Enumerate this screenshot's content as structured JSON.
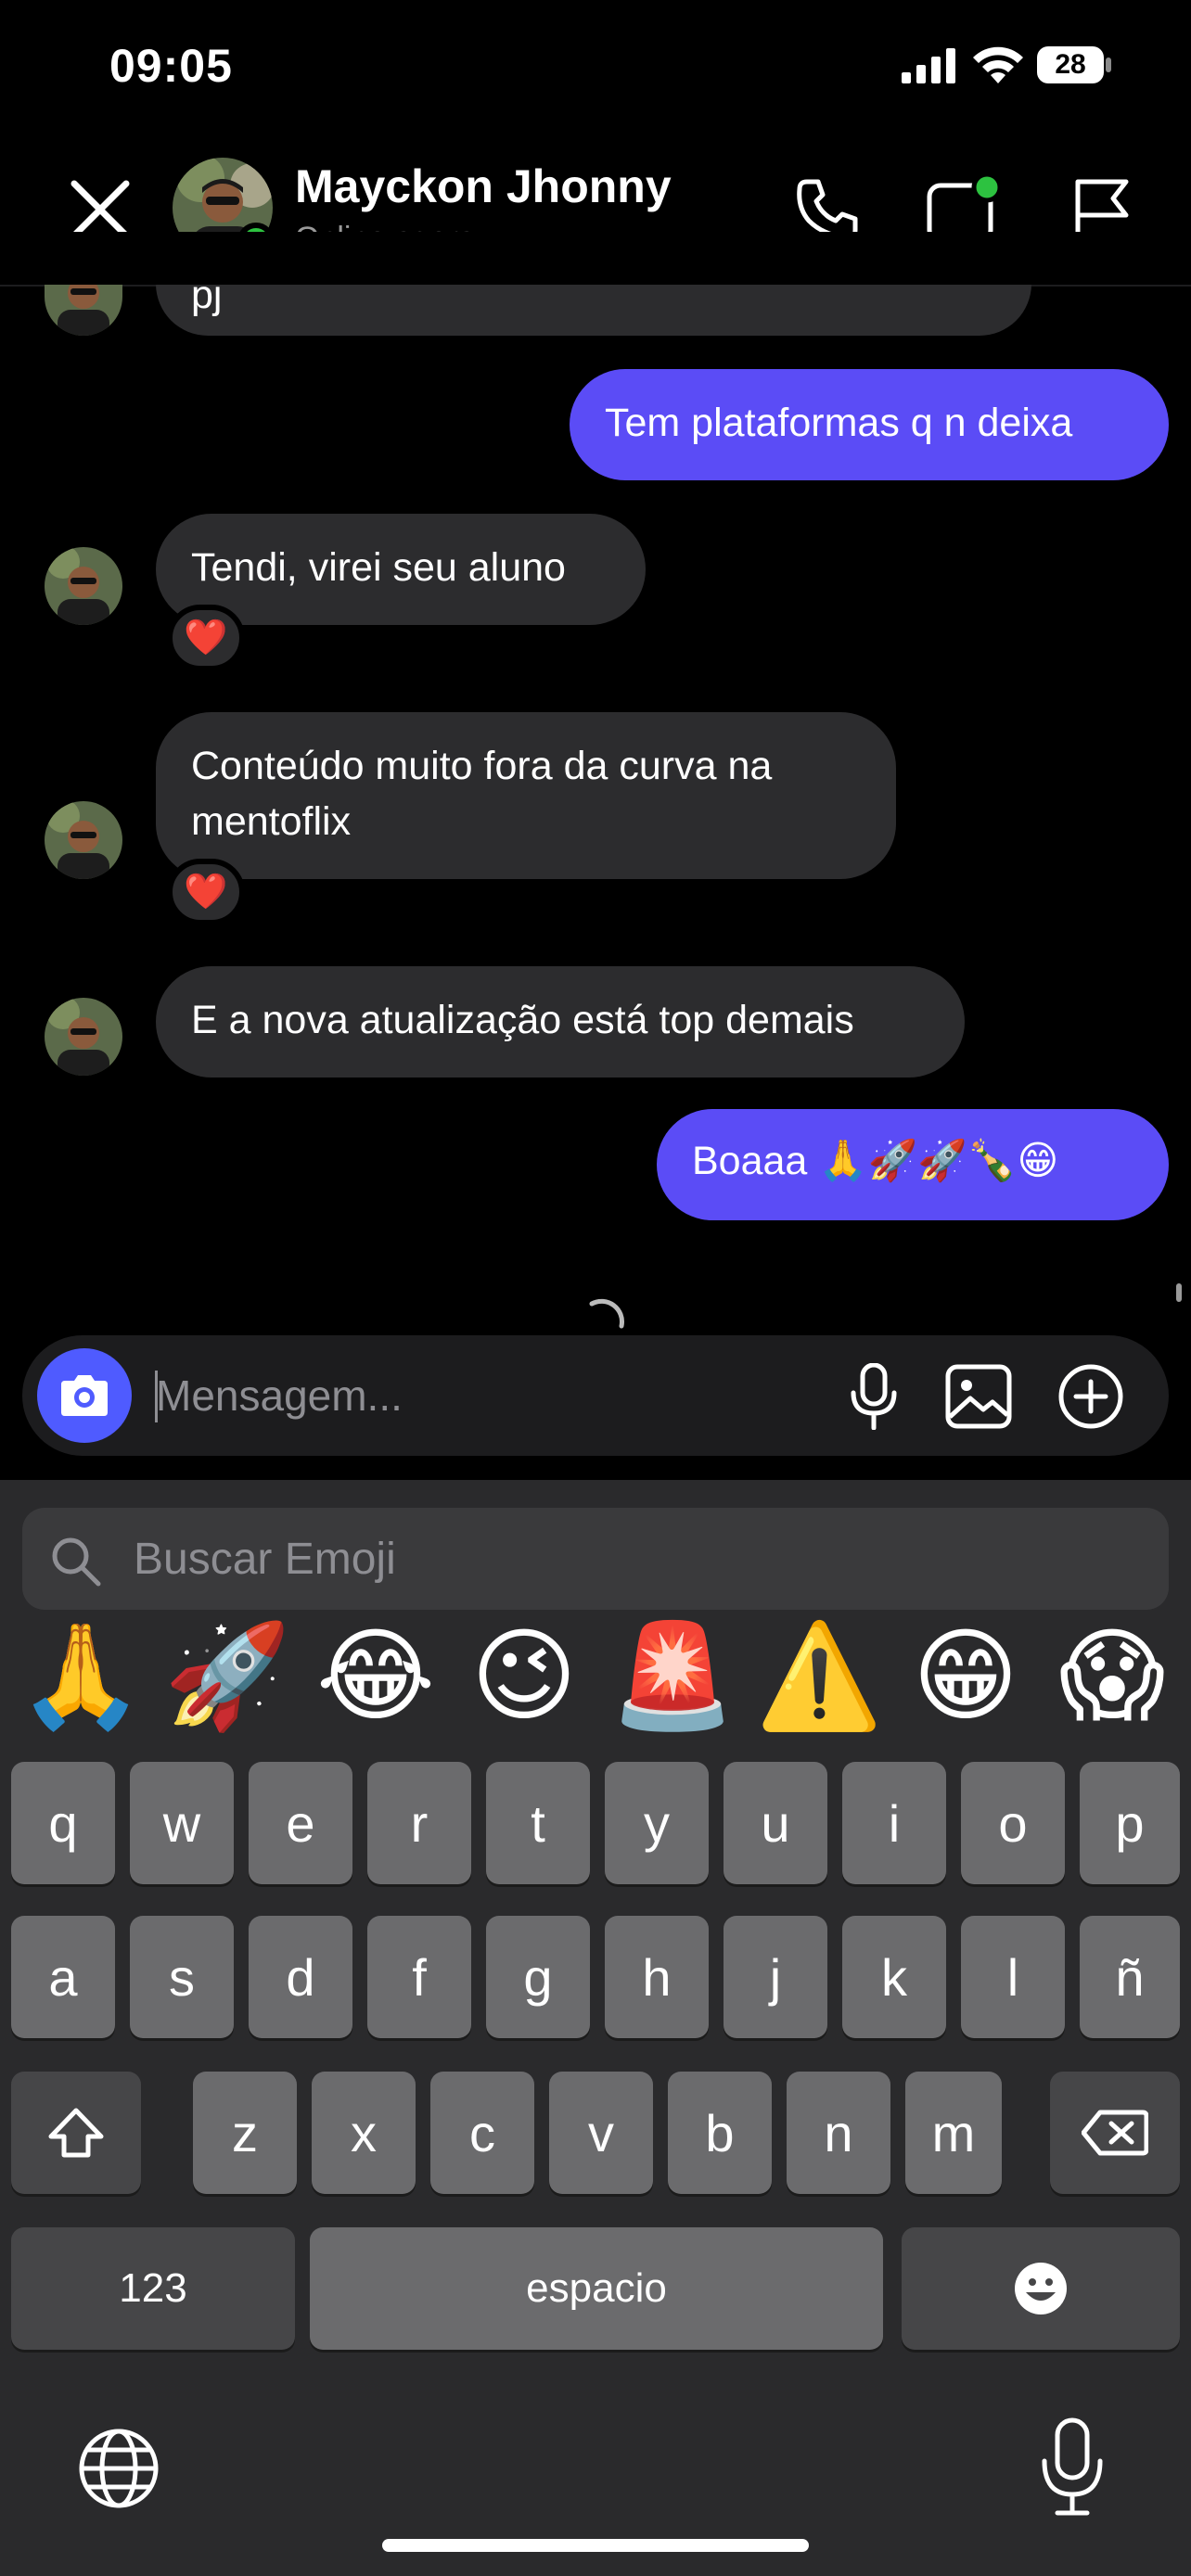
{
  "status_bar": {
    "time": "09:05",
    "battery": "28"
  },
  "header": {
    "contact_name": "Mayckon Jhonny",
    "contact_status": "Online agora"
  },
  "messages": [
    {
      "direction": "in",
      "text": "pj"
    },
    {
      "direction": "out",
      "text": "Tem plataformas q n deixa"
    },
    {
      "direction": "in",
      "text": "Tendi, virei seu aluno",
      "reaction": "❤️"
    },
    {
      "direction": "in",
      "text": "Conteúdo muito fora da curva na mentoflix",
      "reaction": "❤️"
    },
    {
      "direction": "in",
      "text": "E a nova atualização está top demais"
    },
    {
      "direction": "out",
      "text": "Boaaa 🙏🚀🚀🍾😁"
    }
  ],
  "composer": {
    "placeholder": "Mensagem..."
  },
  "emoji_search": {
    "placeholder": "Buscar Emoji"
  },
  "recent_emojis": [
    "🙏",
    "🚀",
    "😂",
    "😉",
    "🚨",
    "⚠️",
    "😁",
    "😱"
  ],
  "keyboard": {
    "row1": [
      "q",
      "w",
      "e",
      "r",
      "t",
      "y",
      "u",
      "i",
      "o",
      "p"
    ],
    "row2": [
      "a",
      "s",
      "d",
      "f",
      "g",
      "h",
      "j",
      "k",
      "l",
      "ñ"
    ],
    "row3": [
      "z",
      "x",
      "c",
      "v",
      "b",
      "n",
      "m"
    ],
    "numbers_label": "123",
    "space_label": "espacio"
  },
  "colors": {
    "accent": "#5b4cf6",
    "online": "#2dc240",
    "incoming_bubble": "#2c2c2e",
    "camera_button": "#4f5bff"
  },
  "icons": [
    "close-icon",
    "phone-icon",
    "video-call-icon",
    "flag-icon",
    "camera-icon",
    "microphone-icon",
    "image-icon",
    "plus-circle-icon",
    "search-icon",
    "shift-icon",
    "backspace-icon",
    "emoji-face-icon",
    "globe-icon"
  ]
}
